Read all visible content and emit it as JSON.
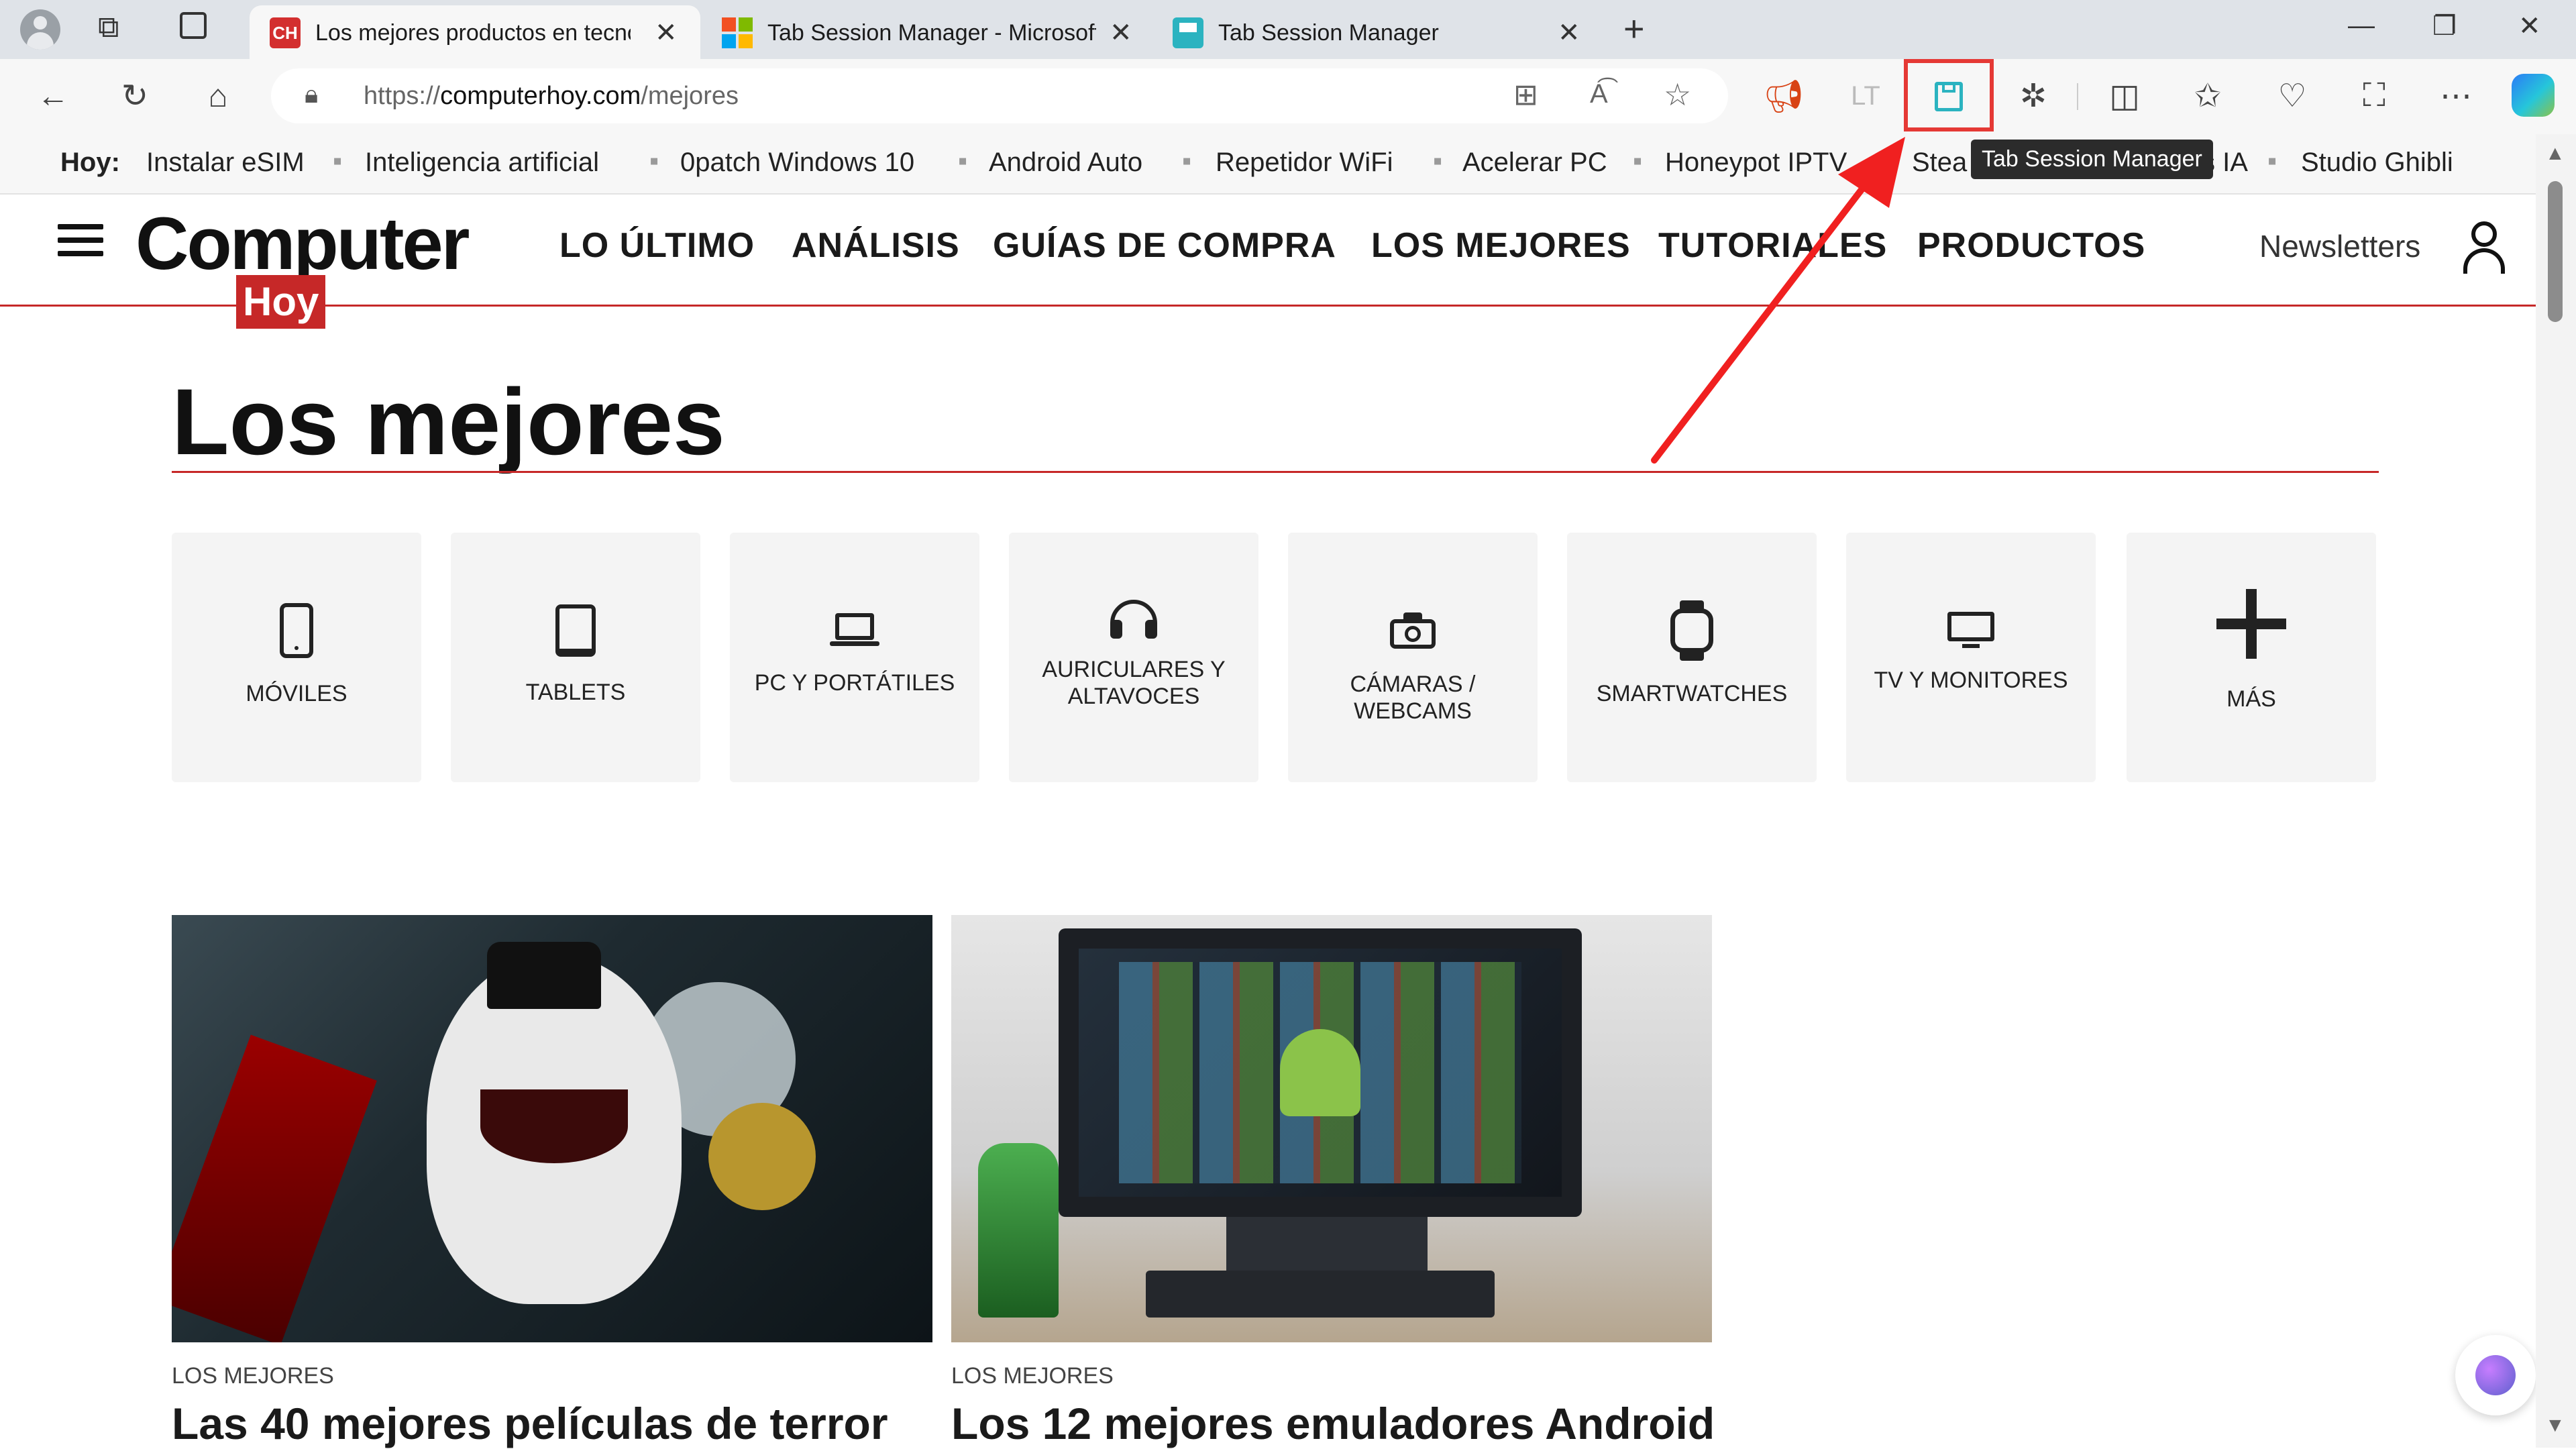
{
  "browser": {
    "tabs": [
      {
        "title": "Los mejores productos en tecnol",
        "favicon": "CH",
        "favicon_color": "#d32f2f",
        "active": true
      },
      {
        "title": "Tab Session Manager - Microsoft",
        "favicon": "ms-store-icon",
        "active": false
      },
      {
        "title": "Tab Session Manager",
        "favicon": "tsm-icon",
        "favicon_color": "#2bb3c0",
        "active": false
      }
    ],
    "url_prefix": "https://",
    "url_domain": "computerhoy.com",
    "url_path": "/mejores",
    "tooltip": "Tab Session Manager",
    "highlight_color": "#e53935"
  },
  "bookmarks": {
    "label": "Hoy:",
    "items": [
      "Instalar eSIM",
      "Inteligencia artificial",
      "0patch Windows 10",
      "Android Auto",
      "Repetidor WiFi",
      "Acelerar PC",
      "Honeypot IPTV",
      "Stea",
      "s IA",
      "Studio Ghibli"
    ]
  },
  "site": {
    "logo_main": "Computer",
    "logo_sub": "Hoy",
    "brand_color": "#c62828",
    "nav": [
      "LO ÚLTIMO",
      "ANÁLISIS",
      "GUÍAS DE COMPRA",
      "LOS MEJORES",
      "TUTORIALES",
      "PRODUCTOS"
    ],
    "newsletters": "Newsletters",
    "page_title": "Los mejores",
    "categories": [
      {
        "label": "MÓVILES",
        "icon": "phone-icon"
      },
      {
        "label": "TABLETS",
        "icon": "tablet-icon"
      },
      {
        "label": "PC Y PORTÁTILES",
        "icon": "laptop-icon"
      },
      {
        "label": "AURICULARES Y ALTAVOCES",
        "icon": "headphones-icon"
      },
      {
        "label": "CÁMARAS / WEBCAMS",
        "icon": "camera-icon"
      },
      {
        "label": "SMARTWATCHES",
        "icon": "watch-icon"
      },
      {
        "label": "TV Y MONITORES",
        "icon": "monitor-icon"
      },
      {
        "label": "MÁS",
        "icon": "plus-icon"
      }
    ],
    "cards": [
      {
        "kicker": "LOS MEJORES",
        "title": "Las 40 mejores películas de terror"
      },
      {
        "kicker": "LOS MEJORES",
        "title": "Los 12 mejores emuladores Android"
      }
    ]
  }
}
